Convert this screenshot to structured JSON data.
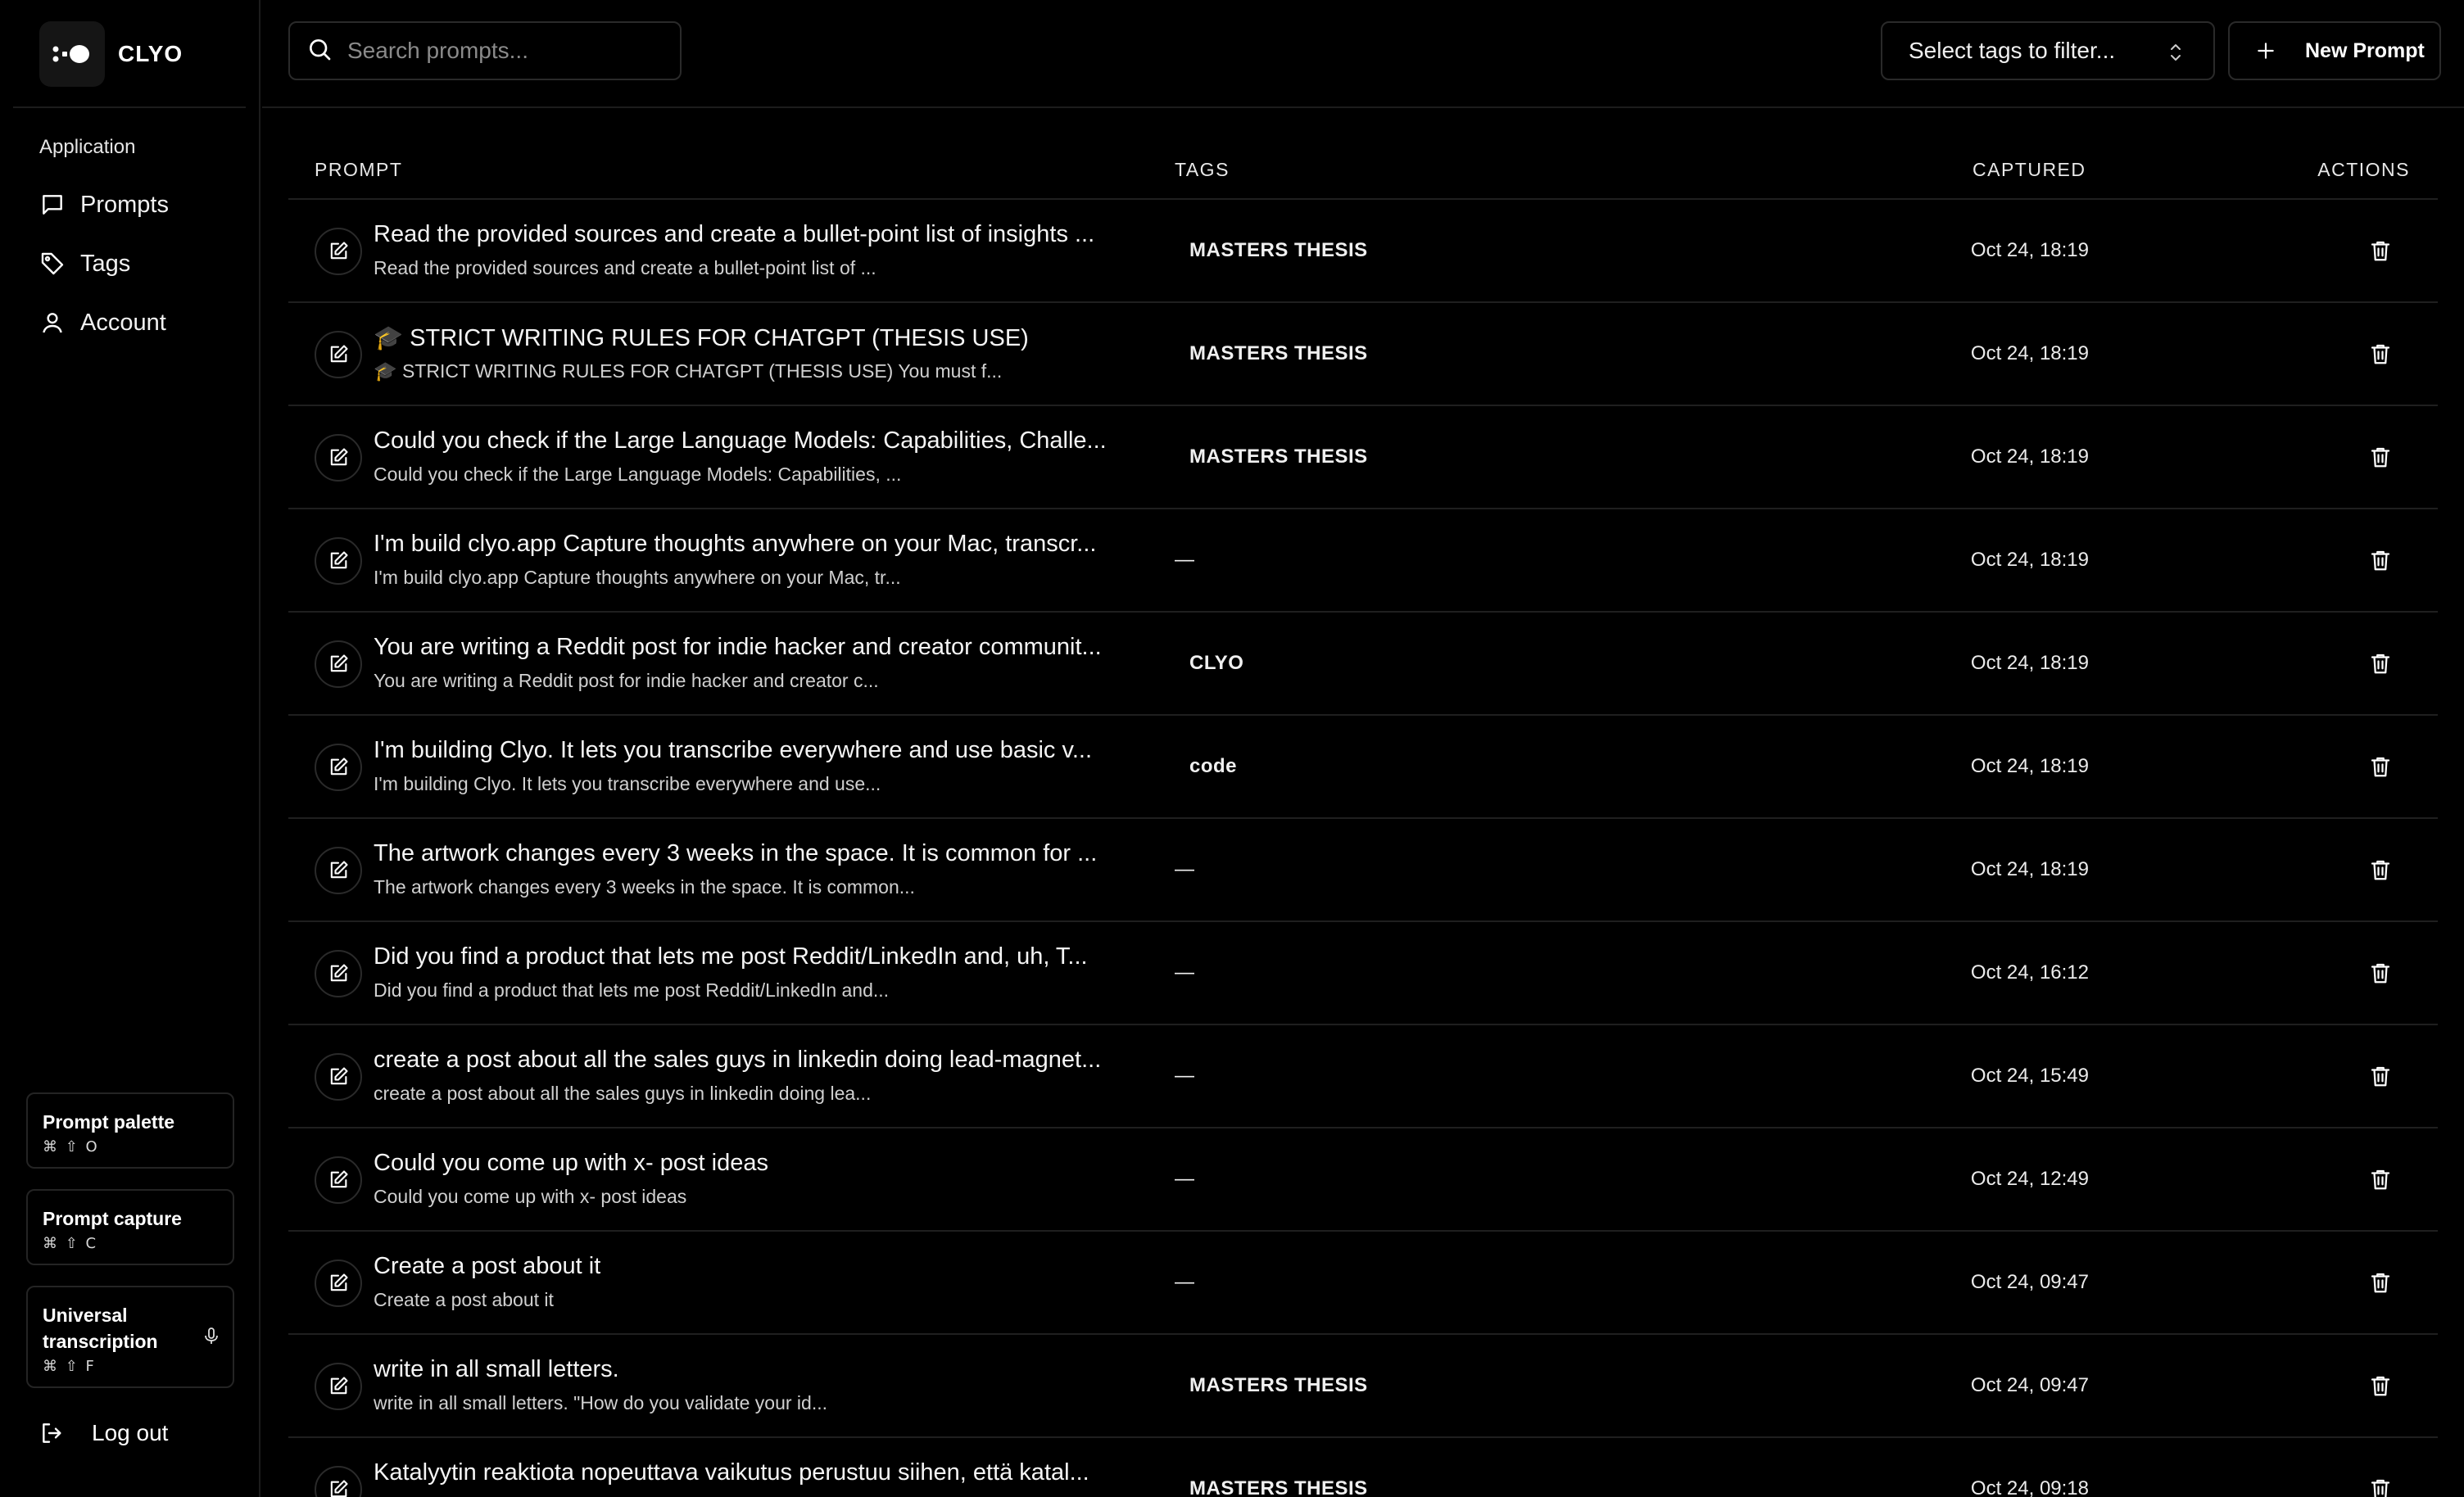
{
  "app": {
    "name": "CLYO"
  },
  "sidebar": {
    "section_label": "Application",
    "items": [
      {
        "label": "Prompts",
        "icon": "message-square-icon"
      },
      {
        "label": "Tags",
        "icon": "tag-icon"
      },
      {
        "label": "Account",
        "icon": "user-icon"
      }
    ],
    "shortcuts": [
      {
        "title": "Prompt palette",
        "keys": "⌘ ⇧ O"
      },
      {
        "title": "Prompt capture",
        "keys": "⌘ ⇧ C"
      },
      {
        "title": "Universal transcription",
        "keys": "⌘ ⇧ F"
      }
    ],
    "logout_label": "Log out"
  },
  "topbar": {
    "search_placeholder": "Search prompts...",
    "tag_filter_label": "Select tags to filter...",
    "new_prompt_label": "New Prompt"
  },
  "table": {
    "headers": {
      "prompt": "PROMPT",
      "tags": "TAGS",
      "captured": "CAPTURED",
      "actions": "ACTIONS"
    },
    "rows": [
      {
        "title": "Read the provided sources and create a bullet-point list of insights ...",
        "subtitle": "Read the provided sources and create a bullet-point list of ...",
        "tag": "MASTERS THESIS",
        "captured": "Oct 24, 18:19"
      },
      {
        "title": "🎓 STRICT WRITING RULES FOR CHATGPT (THESIS USE)",
        "subtitle": "🎓 STRICT WRITING RULES FOR CHATGPT (THESIS USE) You must f...",
        "tag": "MASTERS THESIS",
        "captured": "Oct 24, 18:19"
      },
      {
        "title": "Could you check if the Large Language Models: Capabilities, Challe...",
        "subtitle": "Could you check if the Large Language Models: Capabilities, ...",
        "tag": "MASTERS THESIS",
        "captured": "Oct 24, 18:19"
      },
      {
        "title": "I'm build clyo.app Capture thoughts anywhere on your Mac, transcr...",
        "subtitle": "I'm build clyo.app Capture thoughts anywhere on your Mac, tr...",
        "tag": "—",
        "captured": "Oct 24, 18:19"
      },
      {
        "title": "You are writing a Reddit post for indie hacker and creator communit...",
        "subtitle": "You are writing a Reddit post for indie hacker and creator c...",
        "tag": "CLYO",
        "captured": "Oct 24, 18:19"
      },
      {
        "title": "I'm building Clyo. It lets you transcribe everywhere and use basic v...",
        "subtitle": "I'm building Clyo. It lets you transcribe everywhere and use...",
        "tag": "code",
        "captured": "Oct 24, 18:19"
      },
      {
        "title": "The artwork changes every 3 weeks in the space. It is common for ...",
        "subtitle": "The artwork changes every 3 weeks in the space. It is common...",
        "tag": "—",
        "captured": "Oct 24, 18:19"
      },
      {
        "title": "Did you find a product that lets me post Reddit/LinkedIn and, uh, T...",
        "subtitle": "Did you find a product that lets me post Reddit/LinkedIn and...",
        "tag": "—",
        "captured": "Oct 24, 16:12"
      },
      {
        "title": "create a post about all the sales guys in linkedin doing lead-magnet...",
        "subtitle": "create a post about all the sales guys in linkedin doing lea...",
        "tag": "—",
        "captured": "Oct 24, 15:49"
      },
      {
        "title": "Could you come up with x- post ideas",
        "subtitle": "Could you come up with x- post ideas",
        "tag": "—",
        "captured": "Oct 24, 12:49"
      },
      {
        "title": "Create a post about it",
        "subtitle": "Create a post about it",
        "tag": "—",
        "captured": "Oct 24, 09:47"
      },
      {
        "title": "write in all small letters.",
        "subtitle": "write in all small letters. \"How do you validate your id...",
        "tag": "MASTERS THESIS",
        "captured": "Oct 24, 09:47"
      },
      {
        "title": "Katalyytin reaktiota nopeuttava vaikutus perustuu siihen, että katal...",
        "subtitle": "",
        "tag": "MASTERS THESIS",
        "captured": "Oct 24, 09:18"
      }
    ]
  }
}
